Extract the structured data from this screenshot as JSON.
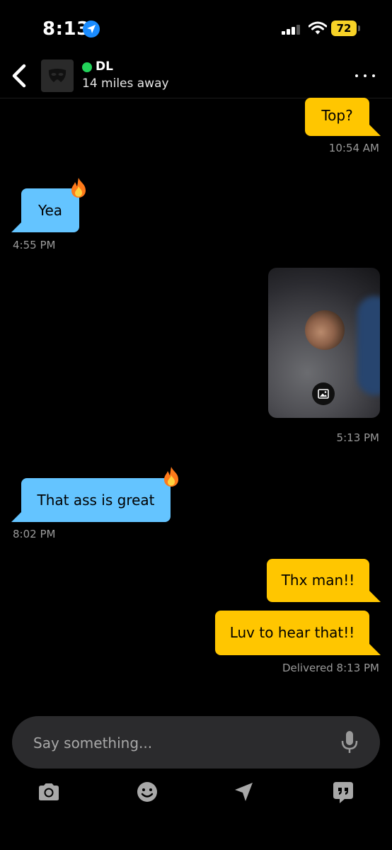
{
  "status_bar": {
    "time": "8:13",
    "battery_level": "72",
    "icons": [
      "location-arrow-icon",
      "cellular-signal-icon",
      "wifi-icon",
      "battery-icon"
    ]
  },
  "header": {
    "back_icon": "chevron-left-icon",
    "user_name": "DL",
    "online": true,
    "distance": "14 miles away",
    "more_icon": "more-dots-icon"
  },
  "colors": {
    "outgoing_bubble": "#ffc600",
    "incoming_bubble": "#64c4ff",
    "online": "#22d35a",
    "background": "#000000"
  },
  "messages": [
    {
      "direction": "out",
      "type": "text",
      "text": "Top?",
      "time": "10:54 AM"
    },
    {
      "direction": "in",
      "type": "text",
      "text": "Yea",
      "time": "4:55 PM",
      "reaction": "fire-emoji"
    },
    {
      "direction": "out",
      "type": "image",
      "time": "5:13 PM",
      "badge_icon": "image-icon"
    },
    {
      "direction": "in",
      "type": "text",
      "text": "That ass is great",
      "time": "8:02 PM",
      "reaction": "fire-emoji"
    },
    {
      "direction": "out",
      "type": "text",
      "text": "Thx man!!"
    },
    {
      "direction": "out",
      "type": "text",
      "text": "Luv to hear that!!",
      "status": "Delivered",
      "time": "8:13 PM"
    }
  ],
  "composer": {
    "placeholder": "Say something...",
    "value": "",
    "mic_icon": "microphone-icon"
  },
  "toolbar": [
    "camera-icon",
    "emoji-smile-icon",
    "location-send-icon",
    "saved-phrases-icon"
  ]
}
